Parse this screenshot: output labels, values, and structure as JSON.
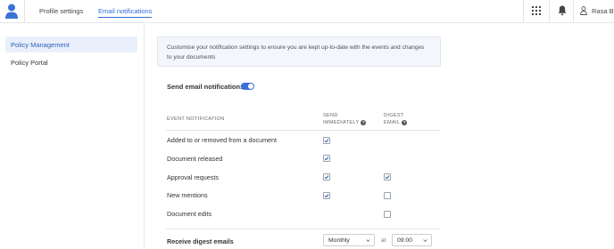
{
  "header": {
    "tabs": [
      {
        "label": "Profile settings",
        "active": false
      },
      {
        "label": "Email notifications",
        "active": true
      }
    ],
    "user_name": "Rasa B.",
    "accent_color": "#2f6fd6"
  },
  "sidebar": {
    "items": [
      {
        "label": "Policy Management",
        "active": true
      },
      {
        "label": "Policy Portal",
        "active": false
      }
    ]
  },
  "main": {
    "info_text_line1": "Customise your notification settings to ensure you are kept up-to-date with the events and changes",
    "info_text_line2": "to your documents",
    "send_email_label": "Send email notifications",
    "send_email_enabled": true,
    "columns": {
      "event": "EVENT NOTIFICATION",
      "send_line1": "SEND",
      "send_line2": "IMMEDIATELY",
      "digest_line1": "DIGEST",
      "digest_line2": "EMAIL"
    },
    "rows": [
      {
        "label": "Added to or removed from a document",
        "send_immediately": true,
        "digest": null
      },
      {
        "label": "Document released",
        "send_immediately": true,
        "digest": null
      },
      {
        "label": "Approval requests",
        "send_immediately": true,
        "digest": true
      },
      {
        "label": "New mentions",
        "send_immediately": true,
        "digest": false
      },
      {
        "label": "Document edits",
        "send_immediately": null,
        "digest": false
      }
    ],
    "digest": {
      "label": "Receive digest emails",
      "frequency": "Monthly",
      "at_label": "at",
      "time": "09:00"
    }
  },
  "icons": {
    "logo": "user-logo-icon",
    "apps": "grid-icon",
    "notifications": "bell-icon",
    "user": "user-icon",
    "help": "question-icon"
  }
}
